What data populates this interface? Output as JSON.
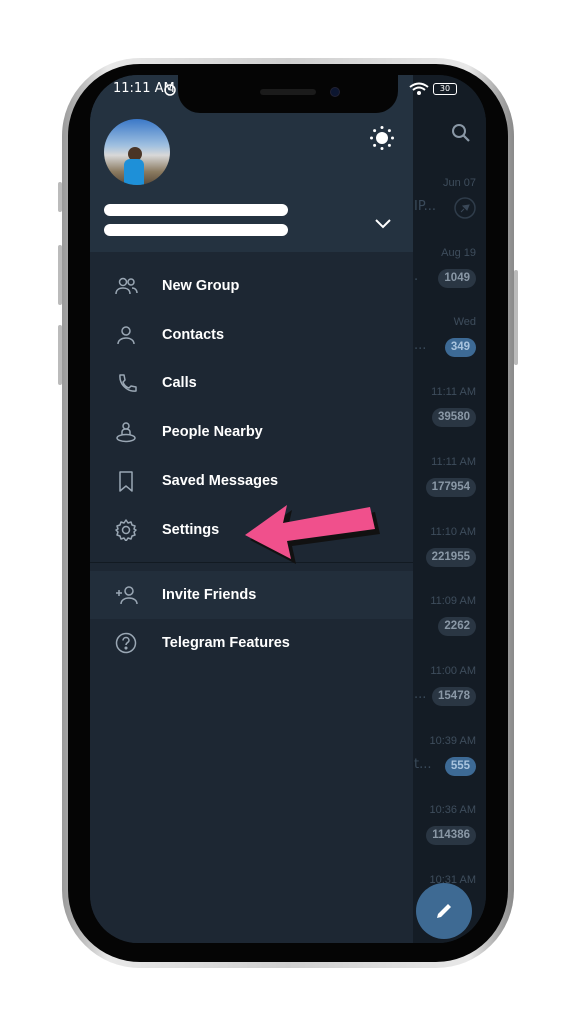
{
  "status_bar": {
    "time": "11:11 AM",
    "battery": "30"
  },
  "drawer": {
    "menu": [
      {
        "label": "New Group",
        "icon": "group-icon"
      },
      {
        "label": "Contacts",
        "icon": "person-icon"
      },
      {
        "label": "Calls",
        "icon": "phone-icon"
      },
      {
        "label": "People Nearby",
        "icon": "people-nearby-icon"
      },
      {
        "label": "Saved Messages",
        "icon": "bookmark-icon"
      },
      {
        "label": "Settings",
        "icon": "gear-icon"
      },
      {
        "label": "Invite Friends",
        "icon": "add-person-icon"
      },
      {
        "label": "Telegram Features",
        "icon": "help-icon"
      }
    ]
  },
  "chats": [
    {
      "date": "Jun 07",
      "snippet": "IP...",
      "pinned": true
    },
    {
      "date": "Aug 19",
      "badge": "1049",
      "snippet": "."
    },
    {
      "date": "Wed",
      "badge": "349",
      "snippet": "...",
      "unmuted": true
    },
    {
      "date": "11:11 AM",
      "badge": "39580"
    },
    {
      "date": "11:11 AM",
      "badge": "177954"
    },
    {
      "date": "11:10 AM",
      "badge": "221955"
    },
    {
      "date": "11:09 AM",
      "badge": "2262"
    },
    {
      "date": "11:00 AM",
      "badge": "15478",
      "snippet": "..."
    },
    {
      "date": "10:39 AM",
      "badge": "555",
      "snippet": "t...",
      "unmuted": true
    },
    {
      "date": "10:36 AM",
      "badge": "114386"
    },
    {
      "date": "10:31 AM"
    }
  ],
  "colors": {
    "accent": "#3e6a93",
    "arrow": "#f0508c",
    "drawer_bg": "#1d2733",
    "header_bg": "#243240"
  }
}
